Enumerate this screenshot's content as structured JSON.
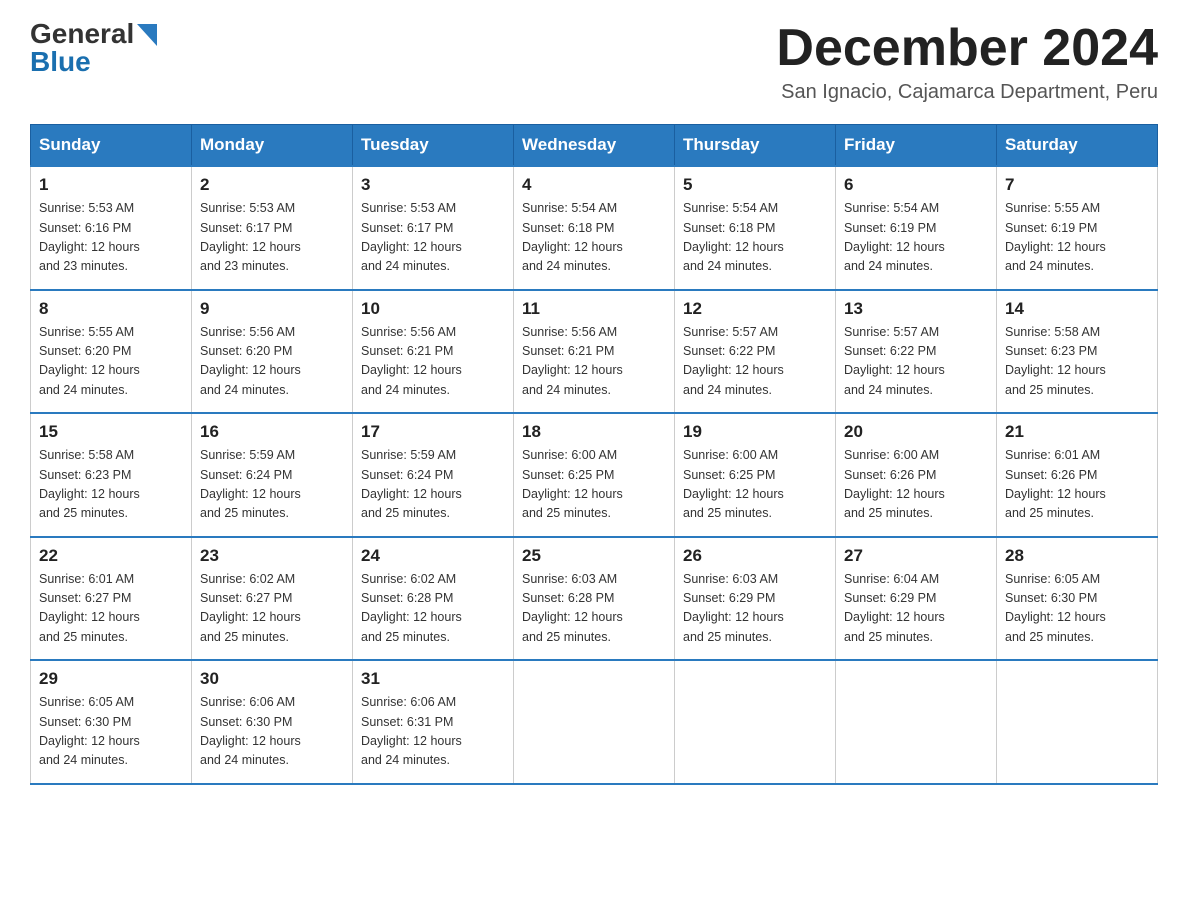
{
  "logo": {
    "general": "General",
    "blue": "Blue"
  },
  "title": "December 2024",
  "subtitle": "San Ignacio, Cajamarca Department, Peru",
  "days_of_week": [
    "Sunday",
    "Monday",
    "Tuesday",
    "Wednesday",
    "Thursday",
    "Friday",
    "Saturday"
  ],
  "weeks": [
    [
      {
        "day": "1",
        "sunrise": "5:53 AM",
        "sunset": "6:16 PM",
        "daylight": "12 hours and 23 minutes."
      },
      {
        "day": "2",
        "sunrise": "5:53 AM",
        "sunset": "6:17 PM",
        "daylight": "12 hours and 23 minutes."
      },
      {
        "day": "3",
        "sunrise": "5:53 AM",
        "sunset": "6:17 PM",
        "daylight": "12 hours and 24 minutes."
      },
      {
        "day": "4",
        "sunrise": "5:54 AM",
        "sunset": "6:18 PM",
        "daylight": "12 hours and 24 minutes."
      },
      {
        "day": "5",
        "sunrise": "5:54 AM",
        "sunset": "6:18 PM",
        "daylight": "12 hours and 24 minutes."
      },
      {
        "day": "6",
        "sunrise": "5:54 AM",
        "sunset": "6:19 PM",
        "daylight": "12 hours and 24 minutes."
      },
      {
        "day": "7",
        "sunrise": "5:55 AM",
        "sunset": "6:19 PM",
        "daylight": "12 hours and 24 minutes."
      }
    ],
    [
      {
        "day": "8",
        "sunrise": "5:55 AM",
        "sunset": "6:20 PM",
        "daylight": "12 hours and 24 minutes."
      },
      {
        "day": "9",
        "sunrise": "5:56 AM",
        "sunset": "6:20 PM",
        "daylight": "12 hours and 24 minutes."
      },
      {
        "day": "10",
        "sunrise": "5:56 AM",
        "sunset": "6:21 PM",
        "daylight": "12 hours and 24 minutes."
      },
      {
        "day": "11",
        "sunrise": "5:56 AM",
        "sunset": "6:21 PM",
        "daylight": "12 hours and 24 minutes."
      },
      {
        "day": "12",
        "sunrise": "5:57 AM",
        "sunset": "6:22 PM",
        "daylight": "12 hours and 24 minutes."
      },
      {
        "day": "13",
        "sunrise": "5:57 AM",
        "sunset": "6:22 PM",
        "daylight": "12 hours and 24 minutes."
      },
      {
        "day": "14",
        "sunrise": "5:58 AM",
        "sunset": "6:23 PM",
        "daylight": "12 hours and 25 minutes."
      }
    ],
    [
      {
        "day": "15",
        "sunrise": "5:58 AM",
        "sunset": "6:23 PM",
        "daylight": "12 hours and 25 minutes."
      },
      {
        "day": "16",
        "sunrise": "5:59 AM",
        "sunset": "6:24 PM",
        "daylight": "12 hours and 25 minutes."
      },
      {
        "day": "17",
        "sunrise": "5:59 AM",
        "sunset": "6:24 PM",
        "daylight": "12 hours and 25 minutes."
      },
      {
        "day": "18",
        "sunrise": "6:00 AM",
        "sunset": "6:25 PM",
        "daylight": "12 hours and 25 minutes."
      },
      {
        "day": "19",
        "sunrise": "6:00 AM",
        "sunset": "6:25 PM",
        "daylight": "12 hours and 25 minutes."
      },
      {
        "day": "20",
        "sunrise": "6:00 AM",
        "sunset": "6:26 PM",
        "daylight": "12 hours and 25 minutes."
      },
      {
        "day": "21",
        "sunrise": "6:01 AM",
        "sunset": "6:26 PM",
        "daylight": "12 hours and 25 minutes."
      }
    ],
    [
      {
        "day": "22",
        "sunrise": "6:01 AM",
        "sunset": "6:27 PM",
        "daylight": "12 hours and 25 minutes."
      },
      {
        "day": "23",
        "sunrise": "6:02 AM",
        "sunset": "6:27 PM",
        "daylight": "12 hours and 25 minutes."
      },
      {
        "day": "24",
        "sunrise": "6:02 AM",
        "sunset": "6:28 PM",
        "daylight": "12 hours and 25 minutes."
      },
      {
        "day": "25",
        "sunrise": "6:03 AM",
        "sunset": "6:28 PM",
        "daylight": "12 hours and 25 minutes."
      },
      {
        "day": "26",
        "sunrise": "6:03 AM",
        "sunset": "6:29 PM",
        "daylight": "12 hours and 25 minutes."
      },
      {
        "day": "27",
        "sunrise": "6:04 AM",
        "sunset": "6:29 PM",
        "daylight": "12 hours and 25 minutes."
      },
      {
        "day": "28",
        "sunrise": "6:05 AM",
        "sunset": "6:30 PM",
        "daylight": "12 hours and 25 minutes."
      }
    ],
    [
      {
        "day": "29",
        "sunrise": "6:05 AM",
        "sunset": "6:30 PM",
        "daylight": "12 hours and 24 minutes."
      },
      {
        "day": "30",
        "sunrise": "6:06 AM",
        "sunset": "6:30 PM",
        "daylight": "12 hours and 24 minutes."
      },
      {
        "day": "31",
        "sunrise": "6:06 AM",
        "sunset": "6:31 PM",
        "daylight": "12 hours and 24 minutes."
      },
      null,
      null,
      null,
      null
    ]
  ],
  "labels": {
    "sunrise": "Sunrise:",
    "sunset": "Sunset:",
    "daylight": "Daylight:"
  }
}
